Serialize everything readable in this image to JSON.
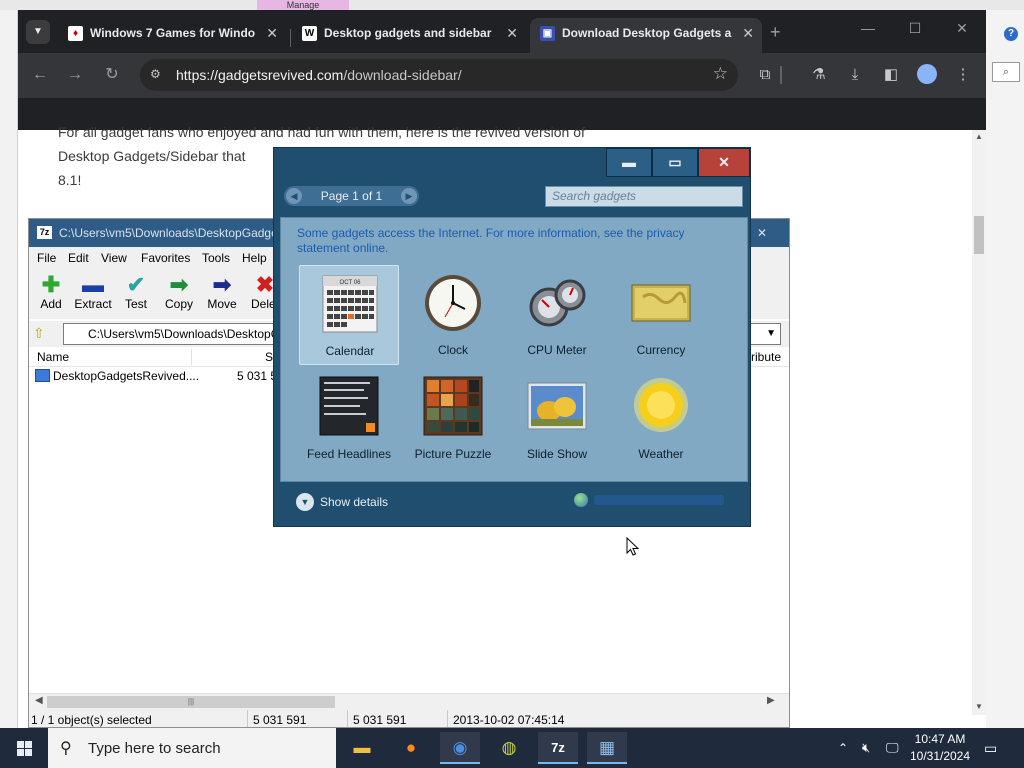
{
  "desktop": {
    "top_item": "Manage"
  },
  "browser": {
    "tabs": [
      {
        "title": "Windows 7 Games for Windo",
        "icon": "card-icon"
      },
      {
        "title": "Desktop gadgets and sidebar",
        "icon": "wikipedia-icon"
      },
      {
        "title": "Download Desktop Gadgets a",
        "icon": "site-icon"
      }
    ],
    "url_host": "https://gadgetsrevived.com",
    "url_path": "/download-sidebar/",
    "page_lines": [
      "For all gadget fans who enjoyed and had fun with them, here is the revived version of",
      "Desktop Gadgets/Sidebar that",
      "8.1!"
    ]
  },
  "zip": {
    "title": "C:\\Users\\vm5\\Downloads\\DesktopGadge",
    "menu": [
      "File",
      "Edit",
      "View",
      "Favorites",
      "Tools",
      "Help"
    ],
    "tools": [
      {
        "label": "Add",
        "glyph": "✚",
        "color": "#2fa832"
      },
      {
        "label": "Extract",
        "glyph": "▬",
        "color": "#1b3fa8"
      },
      {
        "label": "Test",
        "glyph": "✔",
        "color": "#2aa3a3"
      },
      {
        "label": "Copy",
        "glyph": "➡",
        "color": "#1e8f3a"
      },
      {
        "label": "Move",
        "glyph": "➡",
        "color": "#1b2c8f"
      },
      {
        "label": "Delet",
        "glyph": "✖",
        "color": "#d12020"
      }
    ],
    "address": "C:\\Users\\vm5\\Downloads\\DesktopG",
    "columns": {
      "name": "Name",
      "size": "Si",
      "attributes": "ribute"
    },
    "file": {
      "name": "DesktopGadgetsRevived....",
      "size": "5 031 5"
    },
    "status": {
      "selected": "1 / 1 object(s) selected",
      "size1": "5 031 591",
      "size2": "5 031 591",
      "date": "2013-10-02 07:45:14"
    }
  },
  "gadgets": {
    "pager": "Page 1 of 1",
    "search_placeholder": "Search gadgets",
    "notice": "Some gadgets access the Internet.  For more information, see the privacy statement online.",
    "items": [
      {
        "label": "Calendar",
        "icon": "calendar-icon",
        "cal_month": "OCT 06"
      },
      {
        "label": "Clock",
        "icon": "clock-icon"
      },
      {
        "label": "CPU Meter",
        "icon": "cpu-meter-icon"
      },
      {
        "label": "Currency",
        "icon": "currency-icon"
      },
      {
        "label": "Feed Headlines",
        "icon": "feed-icon"
      },
      {
        "label": "Picture Puzzle",
        "icon": "puzzle-icon"
      },
      {
        "label": "Slide Show",
        "icon": "slideshow-icon"
      },
      {
        "label": "Weather",
        "icon": "weather-icon"
      }
    ],
    "show_details": "Show details"
  },
  "taskbar": {
    "search_placeholder": "Type here to search",
    "time": "10:47 AM",
    "date": "10/31/2024"
  }
}
